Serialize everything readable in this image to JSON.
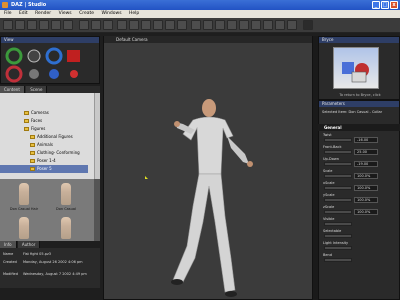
{
  "window": {
    "title": "DAZ | Studio",
    "min": "_",
    "max": "□",
    "close": "x"
  },
  "menu": [
    "File",
    "Edit",
    "Render",
    "Views",
    "Create",
    "Windows",
    "Help"
  ],
  "left": {
    "view_header": "View",
    "tabs": [
      "Content",
      "Scene"
    ],
    "tree": [
      {
        "label": "Cameras",
        "selected": false,
        "indent": 1
      },
      {
        "label": "Faces",
        "selected": false,
        "indent": 1
      },
      {
        "label": "Figures",
        "selected": false,
        "indent": 1
      },
      {
        "label": "Additional Figures",
        "selected": false,
        "indent": 2
      },
      {
        "label": "Animals",
        "selected": false,
        "indent": 2
      },
      {
        "label": "Clothing- Conforming",
        "selected": false,
        "indent": 2
      },
      {
        "label": "Poser 1-4",
        "selected": false,
        "indent": 2
      },
      {
        "label": "Poser 5",
        "selected": true,
        "indent": 2
      }
    ],
    "thumbs": [
      "Don Casual Hair",
      "Don Casual",
      "",
      ""
    ],
    "info_tabs": [
      "Info",
      "Author"
    ],
    "info": [
      {
        "k": "Name",
        "v": "Fist fight 05.pz3"
      },
      {
        "k": "Created",
        "v": "Monday, August 26 2002 4:06 pm"
      },
      {
        "k": "Modified",
        "v": "Wednesday, August 7 2002 4:49 pm"
      }
    ]
  },
  "viewport": {
    "camera": "Default Camera"
  },
  "right": {
    "bryce_header": "Bryce",
    "bryce_caption": "To return to Bryce, click",
    "bryce_button": "Play Bryce",
    "params_header": "Parameters",
    "selected_item": "Selected Item: Don Casual - Collar",
    "group": "General",
    "params": [
      {
        "label": "Twist",
        "value": "-16.00"
      },
      {
        "label": "Front-Back",
        "value": "25.00"
      },
      {
        "label": "Up-Down",
        "value": "-19.00"
      },
      {
        "label": "Scale",
        "value": "100.0%"
      },
      {
        "label": "xScale",
        "value": "100.0%"
      },
      {
        "label": "yScale",
        "value": "100.0%"
      },
      {
        "label": "zScale",
        "value": "100.0%"
      },
      {
        "label": "Visible",
        "value": ""
      },
      {
        "label": "Selectable",
        "value": ""
      },
      {
        "label": "Light Intensity",
        "value": ""
      },
      {
        "label": "Bend",
        "value": ""
      }
    ]
  }
}
